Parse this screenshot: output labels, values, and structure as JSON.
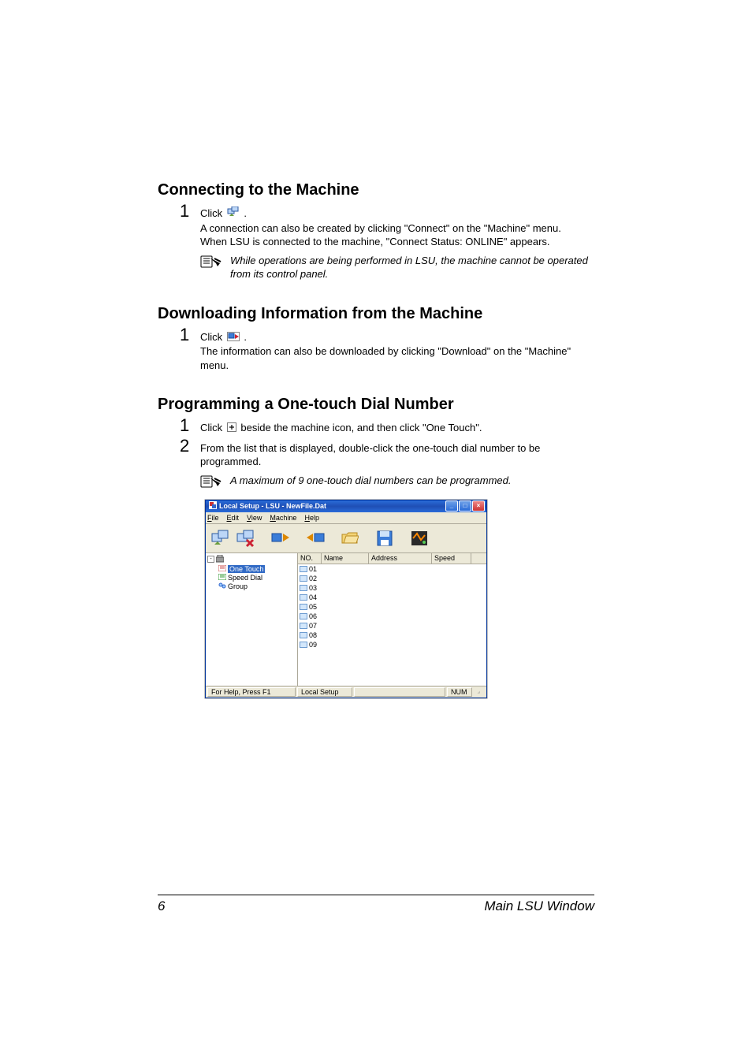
{
  "sections": {
    "connecting": {
      "heading": "Connecting to the Machine",
      "step1_lead": "Click",
      "step1_tail": ".",
      "step1_line2": "A connection can also be created by clicking \"Connect\" on the \"Machine\" menu.",
      "step1_line3": "When LSU is connected to the machine, \"Connect Status: ONLINE\" appears.",
      "note": "While operations are being performed in LSU, the machine cannot be operated from its control panel."
    },
    "downloading": {
      "heading": "Downloading Information from the Machine",
      "step1_lead": "Click",
      "step1_tail": ".",
      "step1_line2": "The information can also be downloaded by clicking \"Download\" on the \"Machine\" menu."
    },
    "programming": {
      "heading": "Programming a One-touch Dial Number",
      "step1_lead": "Click",
      "step1_tail": " beside the machine icon, and then click \"One Touch\".",
      "step2": "From the list that is displayed, double-click the one-touch dial number to be programmed.",
      "note": "A maximum of 9 one-touch dial numbers can be programmed."
    }
  },
  "app": {
    "title": "Local Setup - LSU - NewFile.Dat",
    "menu": {
      "file": "File",
      "edit": "Edit",
      "view": "View",
      "machine": "Machine",
      "help": "Help"
    },
    "tree": {
      "root": " ",
      "one_touch": "One Touch",
      "speed_dial": "Speed Dial",
      "group": "Group"
    },
    "columns": {
      "no": "NO.",
      "name": "Name",
      "address": "Address",
      "speed": "Speed"
    },
    "rows": [
      "01",
      "02",
      "03",
      "04",
      "05",
      "06",
      "07",
      "08",
      "09"
    ],
    "status": {
      "help": "For Help, Press F1",
      "mode": "Local Setup",
      "num": "NUM"
    }
  },
  "footer": {
    "page": "6",
    "title": "Main LSU Window"
  }
}
